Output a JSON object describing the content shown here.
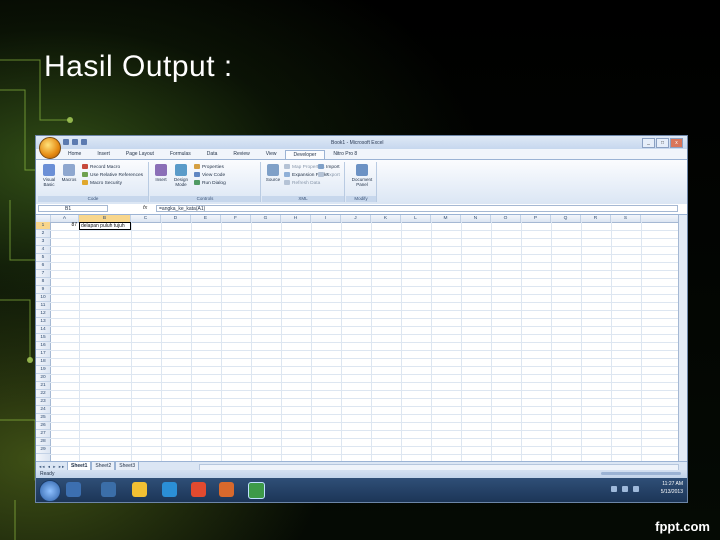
{
  "slide": {
    "title": "Hasil Output :",
    "footer": "fppt.com"
  },
  "window": {
    "title": "Book1 - Microsoft Excel",
    "controls": [
      "_",
      "□",
      "x"
    ]
  },
  "ribbon": {
    "tabs": [
      "Home",
      "Insert",
      "Page Layout",
      "Formulas",
      "Data",
      "Review",
      "View",
      "Developer",
      "Nitro Pro 8"
    ],
    "active_tab": "Developer",
    "groups": {
      "code": {
        "label": "Code",
        "visual_basic": "Visual Basic",
        "macros": "Macros",
        "record_macro": "Record Macro",
        "relative_refs": "Use Relative References",
        "macro_security": "Macro Security"
      },
      "controls": {
        "label": "Controls",
        "insert": "Insert",
        "design_mode": "Design Mode",
        "properties": "Properties",
        "view_code": "View Code",
        "run_dialog": "Run Dialog"
      },
      "xml": {
        "label": "XML",
        "source": "Source",
        "map_properties": "Map Properties",
        "expansion_packs": "Expansion Packs",
        "refresh_data": "Refresh Data",
        "import": "Import",
        "export": "Export"
      },
      "modify": {
        "label": "Modify",
        "document_panel": "Document Panel"
      }
    }
  },
  "formula_bar": {
    "name_box": "B1",
    "fx": "fx",
    "formula": "=angka_ke_kata(A1)"
  },
  "sheet": {
    "columns": [
      "A",
      "B",
      "C",
      "D",
      "E",
      "F",
      "G",
      "H",
      "I",
      "J",
      "K",
      "L",
      "M",
      "N",
      "O",
      "P",
      "Q",
      "R",
      "S"
    ],
    "selected_column": "B",
    "rows": [
      "1",
      "2",
      "3",
      "4",
      "5",
      "6",
      "7",
      "8",
      "9",
      "10",
      "11",
      "12",
      "13",
      "14",
      "15",
      "16",
      "17",
      "18",
      "19",
      "20",
      "21",
      "22",
      "23",
      "24",
      "25",
      "26",
      "27",
      "28",
      "29"
    ],
    "selected_row": "1",
    "a1": "87",
    "b1": "delapan puluh tujuh"
  },
  "sheet_tabs": [
    "Sheet1",
    "Sheet2",
    "Sheet3"
  ],
  "active_sheet": "Sheet1",
  "nav_buttons": "◂◂ ◂ ▸ ▸▸",
  "status_text": "Ready",
  "clock": {
    "time": "11:27 AM",
    "date": "5/13/2013"
  },
  "colors": {
    "accent": "#f8d68c",
    "ribbon": "#dbe6f4",
    "taskbar": "#1c3557"
  }
}
